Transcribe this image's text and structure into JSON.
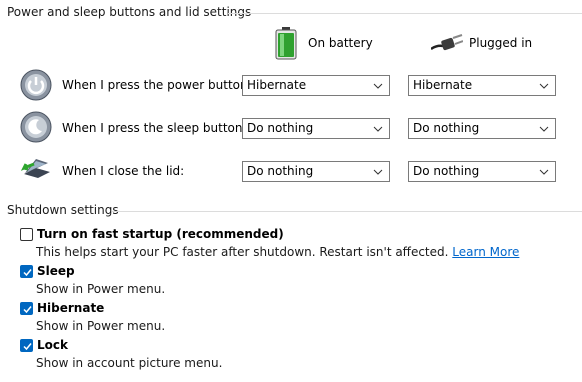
{
  "power_section": {
    "title": "Power and sleep buttons and lid settings",
    "columns": {
      "battery": {
        "label": "On battery",
        "icon": "battery-icon"
      },
      "plugged": {
        "label": "Plugged in",
        "icon": "power-plug-icon"
      }
    },
    "rows": [
      {
        "label": "When I press the power button:",
        "icon": "power-button-icon",
        "battery_value": "Hibernate",
        "plugged_value": "Hibernate"
      },
      {
        "label": "When I press the sleep button:",
        "icon": "sleep-button-icon",
        "battery_value": "Do nothing",
        "plugged_value": "Do nothing"
      },
      {
        "label": "When I close the lid:",
        "icon": "laptop-lid-icon",
        "battery_value": "Do nothing",
        "plugged_value": "Do nothing"
      }
    ]
  },
  "shutdown_section": {
    "title": "Shutdown settings",
    "items": [
      {
        "label": "Turn on fast startup (recommended)",
        "description": "This helps start your PC faster after shutdown. Restart isn't affected.",
        "link": "Learn More",
        "checked": false
      },
      {
        "label": "Sleep",
        "description": "Show in Power menu.",
        "checked": true
      },
      {
        "label": "Hibernate",
        "description": "Show in Power menu.",
        "checked": true
      },
      {
        "label": "Lock",
        "description": "Show in account picture menu.",
        "checked": true
      }
    ]
  },
  "colors": {
    "accent": "#0067c0",
    "link": "#0066cc"
  }
}
